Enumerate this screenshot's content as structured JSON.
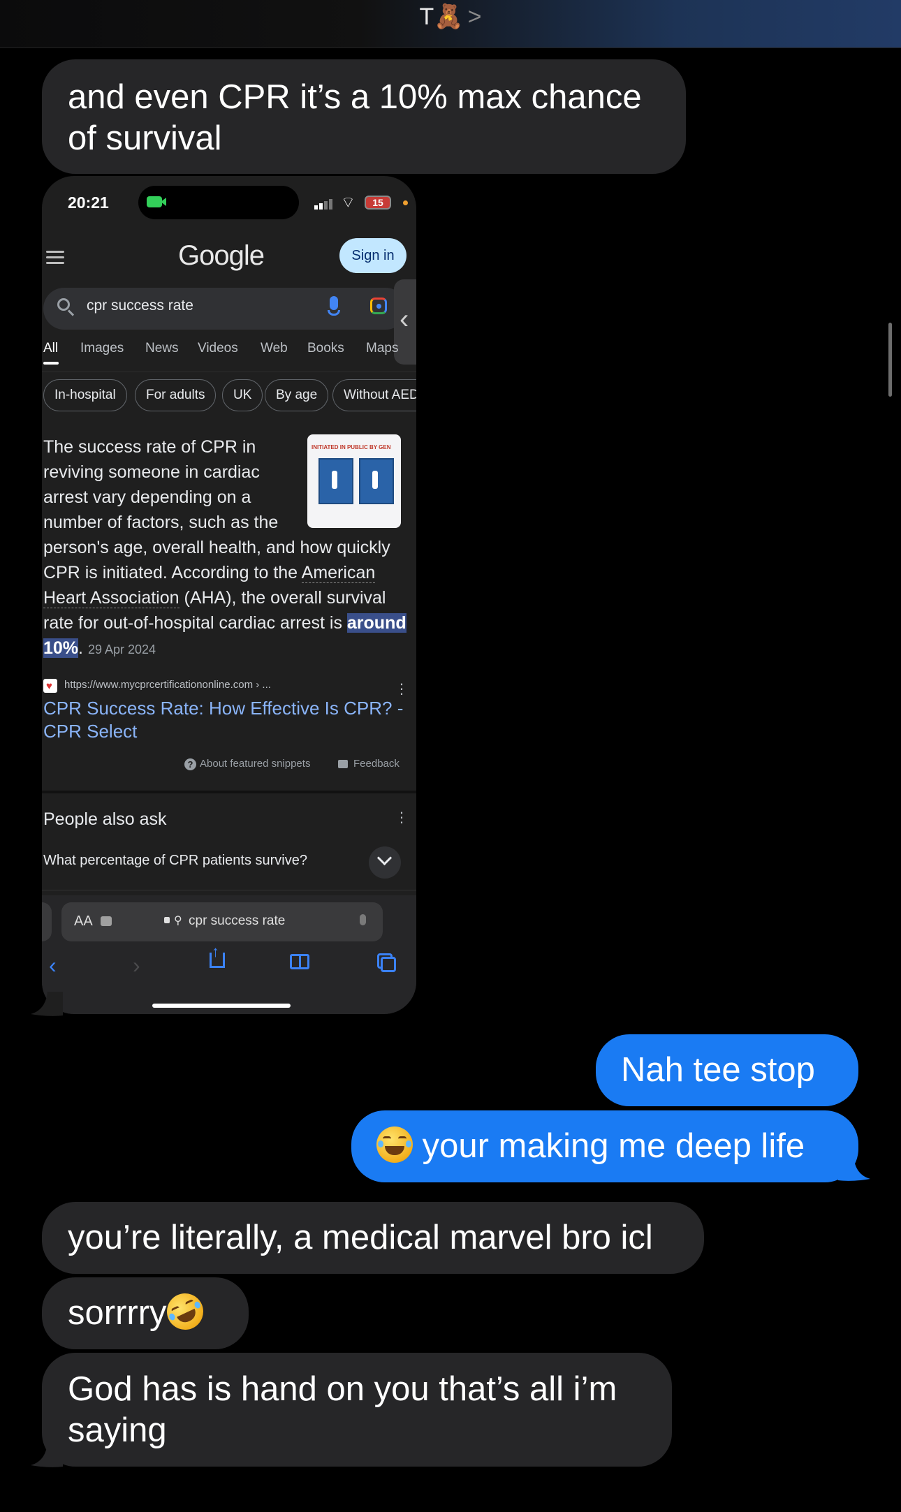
{
  "header": {
    "contact_name": "T🧸",
    "chevron": ">"
  },
  "messages": [
    {
      "direction": "incoming",
      "text": "and even CPR it’s a 10% max chance of survival"
    },
    {
      "direction": "outgoing",
      "text": "Nah tee stop"
    },
    {
      "direction": "outgoing",
      "text": "your making me deep life",
      "emoji": "face-with-tears-of-joy"
    },
    {
      "direction": "incoming",
      "text": "you’re literally, a medical marvel bro icl"
    },
    {
      "direction": "incoming",
      "text": "sorrrry",
      "emoji": "rolling-on-the-floor-laughing"
    },
    {
      "direction": "incoming",
      "text": "God has is hand on you that’s all i’m saying"
    }
  ],
  "screenshot": {
    "status": {
      "time": "20:21",
      "battery": "15"
    },
    "google": {
      "logo": "Google",
      "sign_in": "Sign in",
      "query": "cpr success rate",
      "tabs": [
        "All",
        "Images",
        "News",
        "Videos",
        "Web",
        "Books",
        "Maps"
      ],
      "active_tab": "All",
      "chips": [
        "In-hospital",
        "For adults",
        "UK",
        "By age",
        "Without AED"
      ],
      "snippet": {
        "part1": "The success rate of CPR in reviving someone in cardiac arrest vary depending on a number of factors, such as the person's age, overall health, and how quickly CPR is initiated. According to the ",
        "link": "American Heart Association",
        "part2": " (AHA), the overall survival rate for out-of-hospital cardiac arrest is ",
        "highlight": "around 10%",
        "part3": ".",
        "date": "29 Apr 2024"
      },
      "thumbnail_caption": "INITIATED IN PUBLIC BY GEN",
      "source_url": "https://www.mycprcertificationonline.com › ...",
      "result_title": "CPR Success Rate: How Effective Is CPR? - CPR Select",
      "about_snippets": "About featured snippets",
      "feedback": "Feedback",
      "people_also_ask": "People also ask",
      "paa_question": "What percentage of CPR patients survive?"
    },
    "safari": {
      "aa": "AA",
      "url": "cpr success rate"
    }
  },
  "colors": {
    "incoming_bubble": "#262628",
    "outgoing_bubble": "#1a7bf3",
    "background": "#000000",
    "link": "#8ab4f8"
  }
}
